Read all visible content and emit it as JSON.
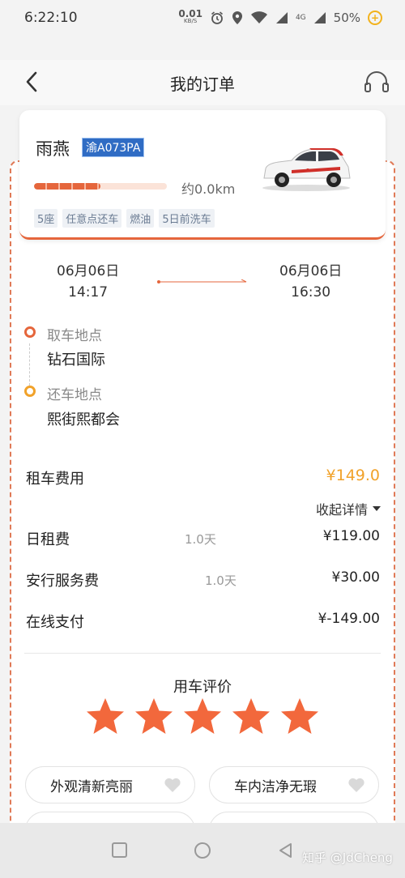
{
  "status_bar": {
    "time": "6:22:10",
    "speed_value": "0.01",
    "speed_unit": "KB/S",
    "network": "4G",
    "battery": "50%"
  },
  "nav": {
    "title": "我的订单",
    "back_icon": "chevron-left-icon",
    "support_icon": "headset-icon"
  },
  "car": {
    "name": "雨燕",
    "plate": "渝A073PA",
    "range_text": "约0.0km",
    "range_fraction": 0.5,
    "tags": [
      "5座",
      "任意点还车",
      "燃油",
      "5日前洗车"
    ]
  },
  "schedule": {
    "pickup_date": "06月06日",
    "pickup_time": "14:17",
    "return_date": "06月06日",
    "return_time": "16:30"
  },
  "locations": {
    "pickup_label": "取车地点",
    "pickup_value": "钻石国际",
    "return_label": "还车地点",
    "return_value": "熙街熙都会"
  },
  "fees": {
    "total_label": "租车费用",
    "total_amount": "¥149.0",
    "collapse_label": "收起详情",
    "items": [
      {
        "label": "日租费",
        "qty": "1.0天",
        "amount": "¥119.00"
      },
      {
        "label": "安行服务费",
        "qty": "1.0天",
        "amount": "¥30.00"
      },
      {
        "label": "在线支付",
        "qty": "",
        "amount": "¥-149.00"
      }
    ]
  },
  "rating": {
    "title": "用车评价",
    "stars": 5,
    "star_color": "#f2683c",
    "tags": [
      "外观清新亮丽",
      "车内洁净无瑕"
    ]
  },
  "watermark": "知乎 @JdCheng",
  "colors": {
    "accent": "#e5663c",
    "price": "#f1a22a",
    "plate_bg": "#2f6cc4"
  }
}
